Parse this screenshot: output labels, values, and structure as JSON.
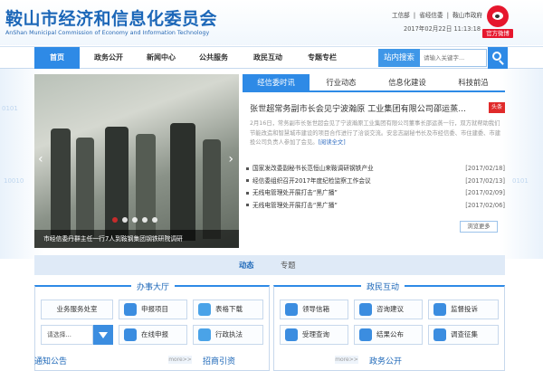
{
  "header": {
    "title": "鞍山市经济和信息化委员会",
    "subtitle": "AnShan Municipal Commission of Economy and Information Technology",
    "links": [
      "工信部",
      "省经信委",
      "鞍山市政府"
    ],
    "link_sep": "|",
    "datetime": "2017年02月22日  11:13:18",
    "weibo_label": "官方微博"
  },
  "nav": {
    "items": [
      "首页",
      "政务公开",
      "新闻中心",
      "公共服务",
      "政民互动",
      "专题专栏"
    ],
    "search_label": "站内搜索",
    "search_placeholder": "请输入关键字..."
  },
  "slider": {
    "caption": "市经信委丹群主任一行7人到鞍钢集团钢铁研院调研",
    "dot_count": 5,
    "active_dot": 0
  },
  "news": {
    "tabs": [
      "经信委时讯",
      "行业动态",
      "信息化建设",
      "科技前沿"
    ],
    "headline": "张世超常务副市长会见宁波瀚原 工业集团有限公司邵运蒸...",
    "headline_badge": "头条",
    "summary": "2月16日，常务副市长张世超会见了宁波瀚原工业集团有限公司董事长邵运蒸一行，双方就帮助我们节能改造和智慧城市建设的项目合作进行了洽谈交流。安忠志副秘书长及市经信委、市住建委、市建投公司负责人参加了会见。",
    "summary_more": "[阅读全文]",
    "items": [
      {
        "title": "国家发改委副秘书长范恒山来鞍调研钢铁产业",
        "date": "[2017/02/18]"
      },
      {
        "title": "经信委组织召开2017年度纪检监察工作会议",
        "date": "[2017/02/13]"
      },
      {
        "title": "无线电管理处开展打击“黑广播”",
        "date": "[2017/02/09]"
      },
      {
        "title": "无线电管理处开展打击“黑广播”",
        "date": "[2017/02/06]"
      }
    ],
    "browse_more": "浏览更多"
  },
  "ticker": {
    "items": [
      "动态",
      "专题"
    ]
  },
  "office": {
    "title": "办事大厅",
    "buttons": [
      "业务服务处室",
      "申报项目",
      "表格下载",
      "在线申报",
      "行政执法"
    ],
    "select_value": "请选择..."
  },
  "interact": {
    "title": "政民互动",
    "buttons": [
      "领导信箱",
      "咨询建议",
      "监督投诉",
      "受理查询",
      "结果公布",
      "调查征集"
    ]
  },
  "bottom": {
    "titles": [
      "通知公告",
      "招商引资",
      "政务公开"
    ],
    "more": "more>>"
  },
  "colors": {
    "accent": "#2e8ae6",
    "brand": "#1c67b8",
    "badge": "#e02a2a"
  }
}
